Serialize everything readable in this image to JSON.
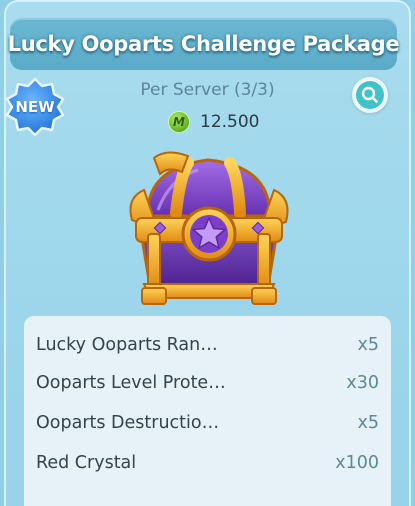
{
  "package": {
    "title": "Lucky Ooparts Challenge Package",
    "badge": "NEW",
    "purchase_limit": "Per Server (3/3)",
    "price": "12.500",
    "currency_icon": "m-coin-icon",
    "currency_symbol": "M"
  },
  "items": [
    {
      "name": "Lucky Ooparts Ran…",
      "qty": "x5"
    },
    {
      "name": "Ooparts Level Prote…",
      "qty": "x30"
    },
    {
      "name": "Ooparts Destructio…",
      "qty": "x5"
    },
    {
      "name": "Red Crystal",
      "qty": "x100"
    }
  ],
  "colors": {
    "card_bg": "#9dd6eb",
    "title_bar": "#5aaac8",
    "badge_blue": "#2f86e6",
    "chest_purple": "#7a3fc4",
    "chest_gold": "#f2a81d"
  }
}
